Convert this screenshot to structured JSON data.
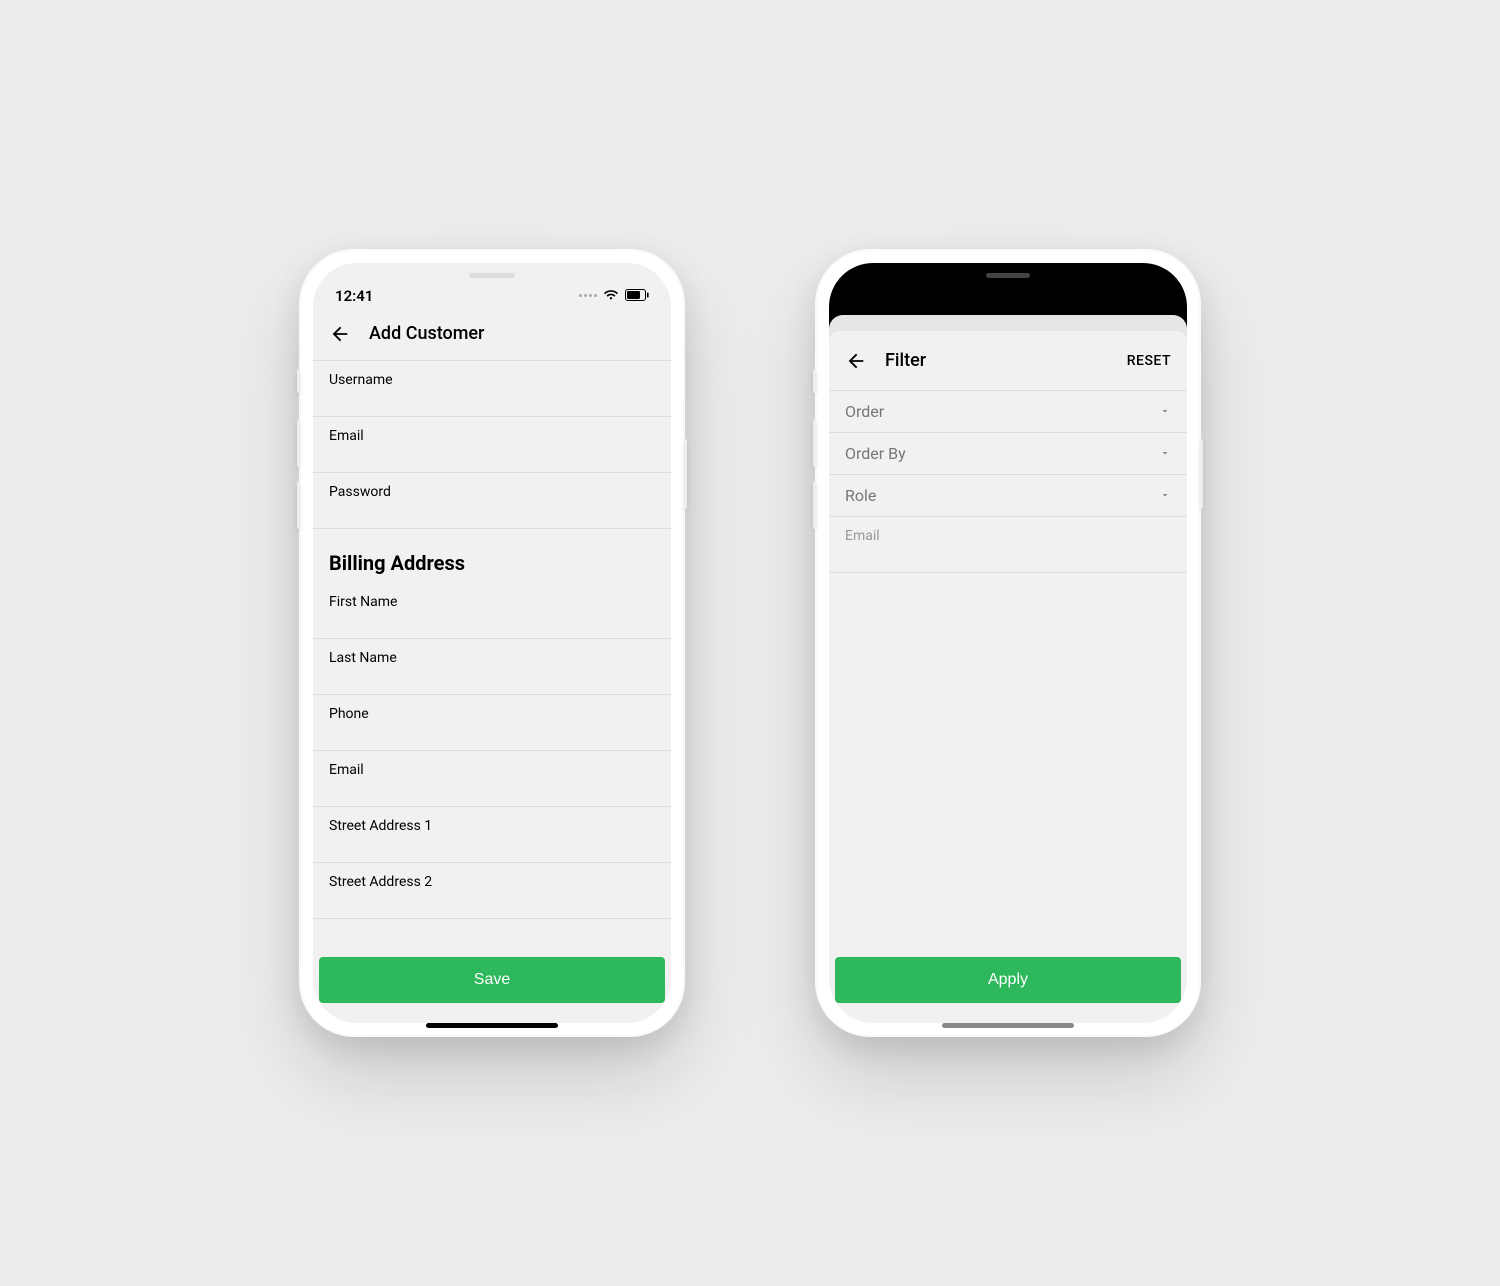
{
  "left": {
    "status_time": "12:41",
    "header": {
      "title": "Add Customer"
    },
    "fields": {
      "username_label": "Username",
      "email_label": "Email",
      "password_label": "Password"
    },
    "billing": {
      "heading": "Billing Address",
      "first_name_label": "First Name",
      "last_name_label": "Last Name",
      "phone_label": "Phone",
      "email_label": "Email",
      "street_1_label": "Street Address 1",
      "street_2_label": "Street Address 2"
    },
    "save_label": "Save"
  },
  "right": {
    "header": {
      "title": "Filter",
      "reset_label": "RESET"
    },
    "selects": {
      "order_label": "Order",
      "order_by_label": "Order By",
      "role_label": "Role"
    },
    "email_label": "Email",
    "apply_label": "Apply"
  },
  "colors": {
    "primary": "#2eb85c",
    "background": "#ededed"
  }
}
